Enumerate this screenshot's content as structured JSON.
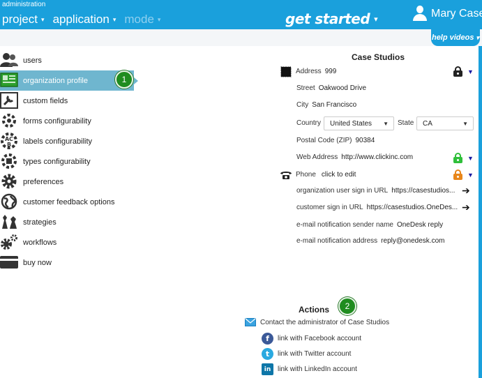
{
  "topbar": {
    "section_label": "administration",
    "nav": [
      {
        "label": "project",
        "caret": "▾"
      },
      {
        "label": "application",
        "caret": "▾"
      },
      {
        "label": "mode",
        "caret": "▾"
      }
    ],
    "get_started": "get started",
    "get_started_caret": "▾",
    "user_name": "Mary Case"
  },
  "help": {
    "label": "help videos",
    "caret": "▾"
  },
  "sidebar": {
    "items": [
      {
        "label": "users",
        "icon": "users-icon"
      },
      {
        "label": "organization profile",
        "icon": "organization-profile-icon",
        "active": true
      },
      {
        "label": "custom fields",
        "icon": "custom-fields-icon"
      },
      {
        "label": "forms configurability",
        "icon": "forms-icon"
      },
      {
        "label": "labels configurability",
        "icon": "labels-icon"
      },
      {
        "label": "types configurability",
        "icon": "types-icon"
      },
      {
        "label": "preferences",
        "icon": "gear-icon"
      },
      {
        "label": "customer feedback options",
        "icon": "globe-icon"
      },
      {
        "label": "strategies",
        "icon": "chess-icon"
      },
      {
        "label": "workflows",
        "icon": "gears-icon"
      },
      {
        "label": "buy now",
        "icon": "credit-card-icon"
      }
    ]
  },
  "badges": {
    "one": "1",
    "two": "2"
  },
  "profile": {
    "title": "Case Studios",
    "address_label": "Address",
    "address_value": "999",
    "street_label": "Street",
    "street_value": "Oakwood Drive",
    "city_label": "City",
    "city_value": "San Francisco",
    "country_label": "Country",
    "country_value": "United States",
    "state_label": "State",
    "state_value": "CA",
    "zip_label": "Postal Code (ZIP)",
    "zip_value": "90384",
    "web_label": "Web Address",
    "web_value": "http://www.clickinc.com",
    "phone_label": "Phone",
    "phone_value": "click to edit",
    "org_url_label": "organization user sign in URL",
    "org_url_value": "https://casestudios...",
    "cust_url_label": "customer sign in URL",
    "cust_url_value": "https://casestudios.OneDes...",
    "sender_label": "e-mail notification sender name",
    "sender_value": "OneDesk reply",
    "notif_label": "e-mail notification address",
    "notif_value": "reply@onedesk.com",
    "dropdown_caret": "▼",
    "arrow_glyph": "➔"
  },
  "colors": {
    "lock_dark": "#222222",
    "lock_public": "#2fbf3a",
    "lock_partial": "#e8861a",
    "accent": "#1aa0dc"
  },
  "actions": {
    "title": "Actions",
    "contact": "Contact the administrator of Case Studios",
    "facebook": "link with Facebook account",
    "twitter": "link with Twitter account",
    "linkedin": "link with LinkedIn account",
    "facebook_glyph": "f",
    "twitter_glyph": "t",
    "linkedin_glyph": "in"
  }
}
